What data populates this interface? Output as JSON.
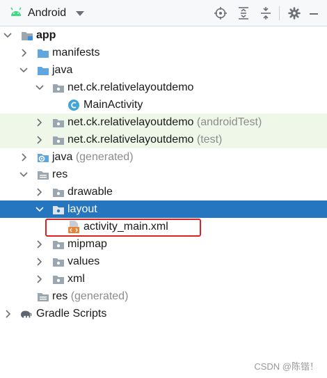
{
  "toolbar": {
    "view_title": "Android",
    "icons": [
      "android-icon",
      "chevron-down-icon",
      "locate-icon",
      "expand-all-icon",
      "collapse-all-icon",
      "gear-icon",
      "minimize-icon"
    ]
  },
  "tree": {
    "app": "app",
    "manifests": "manifests",
    "java": "java",
    "pkg_main": "net.ck.relativelayoutdemo",
    "main_activity": "MainActivity",
    "pkg_android_test": "net.ck.relativelayoutdemo",
    "pkg_android_test_suffix": "(androidTest)",
    "pkg_test": "net.ck.relativelayoutdemo",
    "pkg_test_suffix": "(test)",
    "java_generated": "java",
    "java_generated_suffix": "(generated)",
    "res": "res",
    "drawable": "drawable",
    "layout": "layout",
    "activity_main": "activity_main.xml",
    "mipmap": "mipmap",
    "values": "values",
    "xml": "xml",
    "res_generated": "res",
    "res_generated_suffix": "(generated)",
    "gradle_scripts": "Gradle Scripts"
  },
  "colors": {
    "selection": "#2675bf",
    "test_tint": "#eef7e8",
    "highlight_border": "#e02020",
    "folder_blue": "#5fa7de",
    "folder_gray": "#9aa7b0",
    "android_green": "#3ddc84",
    "class_icon": "#40a5d8",
    "xml_icon": "#e8843a"
  },
  "watermark": "CSDN @陈锴！"
}
